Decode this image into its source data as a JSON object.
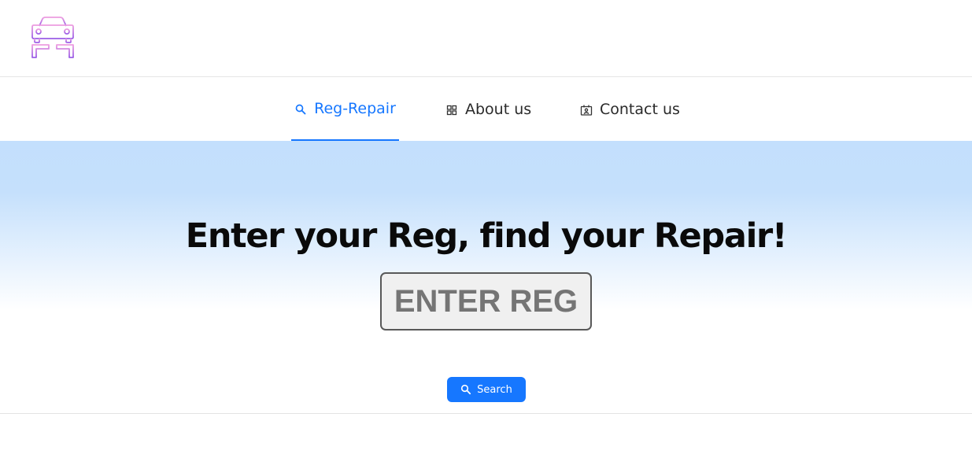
{
  "header": {
    "logo_icon": "car-lift-icon"
  },
  "nav": {
    "tabs": [
      {
        "label": "Reg-Repair",
        "icon": "search-icon",
        "active": true
      },
      {
        "label": "About us",
        "icon": "grid-icon",
        "active": false
      },
      {
        "label": "Contact us",
        "icon": "contact-card-icon",
        "active": false
      }
    ]
  },
  "hero": {
    "title": "Enter your Reg, find your Repair!",
    "reg_input": {
      "placeholder": "ENTER REG",
      "value": ""
    },
    "search_button": {
      "label": "Search",
      "icon": "search-icon"
    }
  },
  "colors": {
    "accent": "#1677ff",
    "hero_gradient_top": "#c3dffd",
    "logo_pink": "#e59ad8",
    "logo_purple": "#9b5ce0"
  }
}
